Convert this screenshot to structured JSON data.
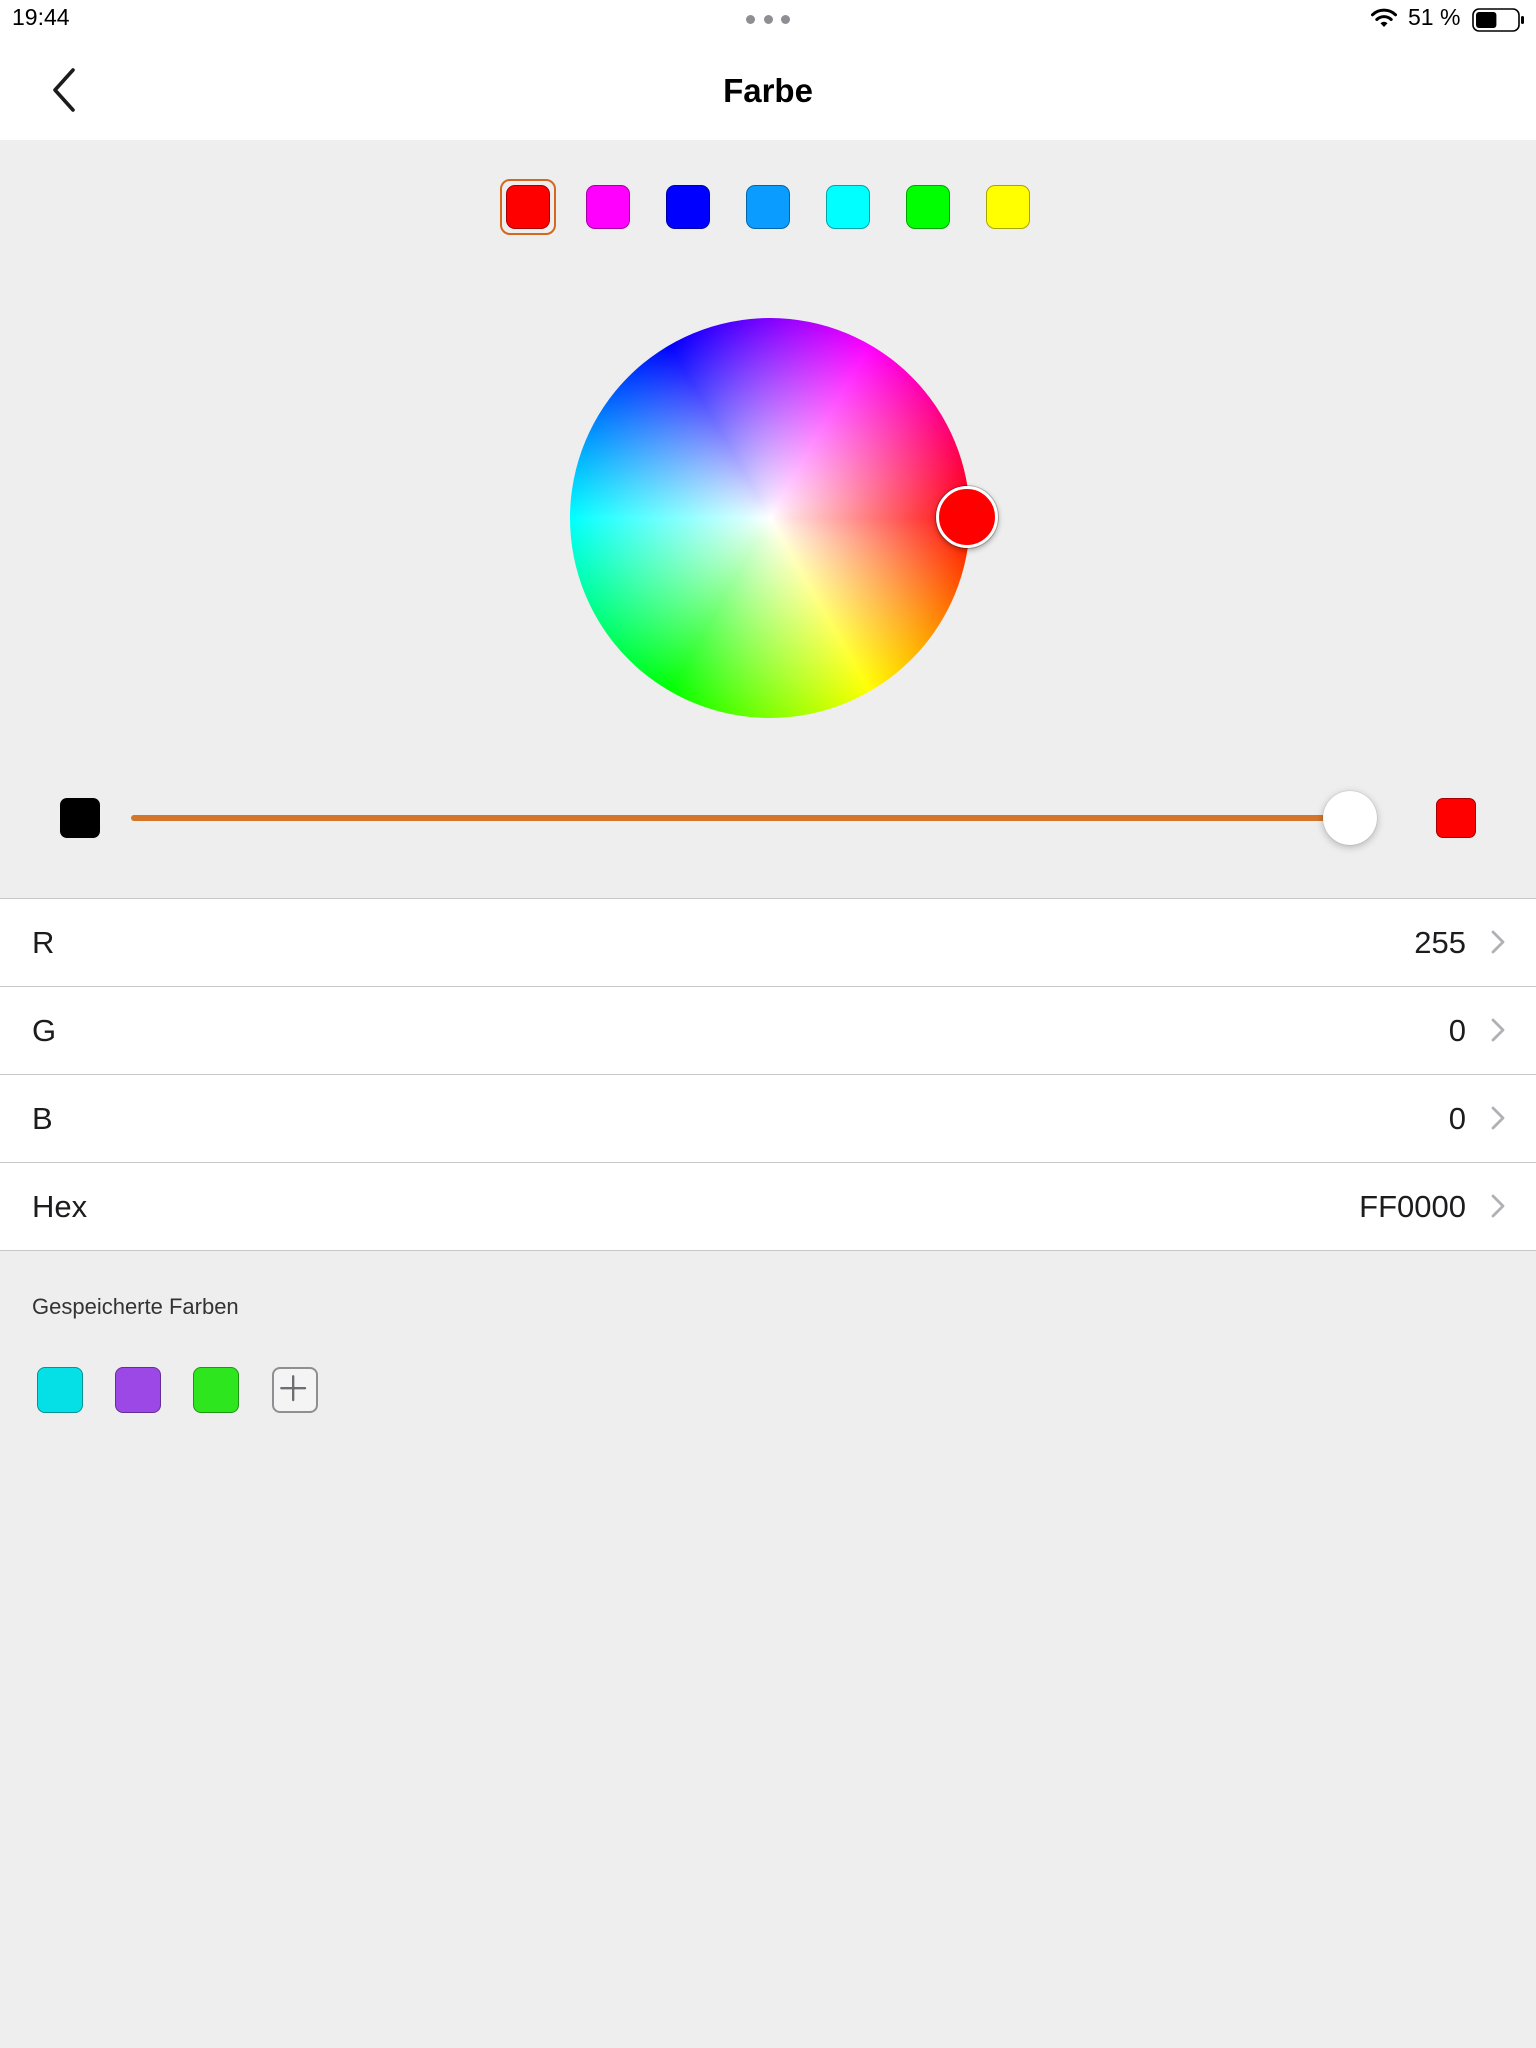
{
  "status_bar": {
    "time": "19:44",
    "battery_percent": "51 %",
    "battery_level": 0.51
  },
  "nav": {
    "title": "Farbe",
    "back_icon": "chevron-left-icon"
  },
  "presets": {
    "selected_index": 0,
    "selection_color": "#d2691e",
    "colors": [
      "#ff0000",
      "#ff00ff",
      "#0000ff",
      "#0a9cff",
      "#00ffff",
      "#00ff00",
      "#ffff00"
    ]
  },
  "current_color": {
    "hex_color": "#ff0000",
    "brightness": 1.0
  },
  "slider": {
    "min_color": "#000000",
    "max_color": "#ff0000",
    "track_color": "#d4762a"
  },
  "rows": [
    {
      "label": "R",
      "value": "255"
    },
    {
      "label": "G",
      "value": "0"
    },
    {
      "label": "B",
      "value": "0"
    },
    {
      "label": "Hex",
      "value": "FF0000"
    }
  ],
  "saved": {
    "heading": "Gespeicherte Farben",
    "colors": [
      "#05e0e6",
      "#9b48e6",
      "#2ee61e"
    ],
    "add_icon": "plus-icon"
  }
}
